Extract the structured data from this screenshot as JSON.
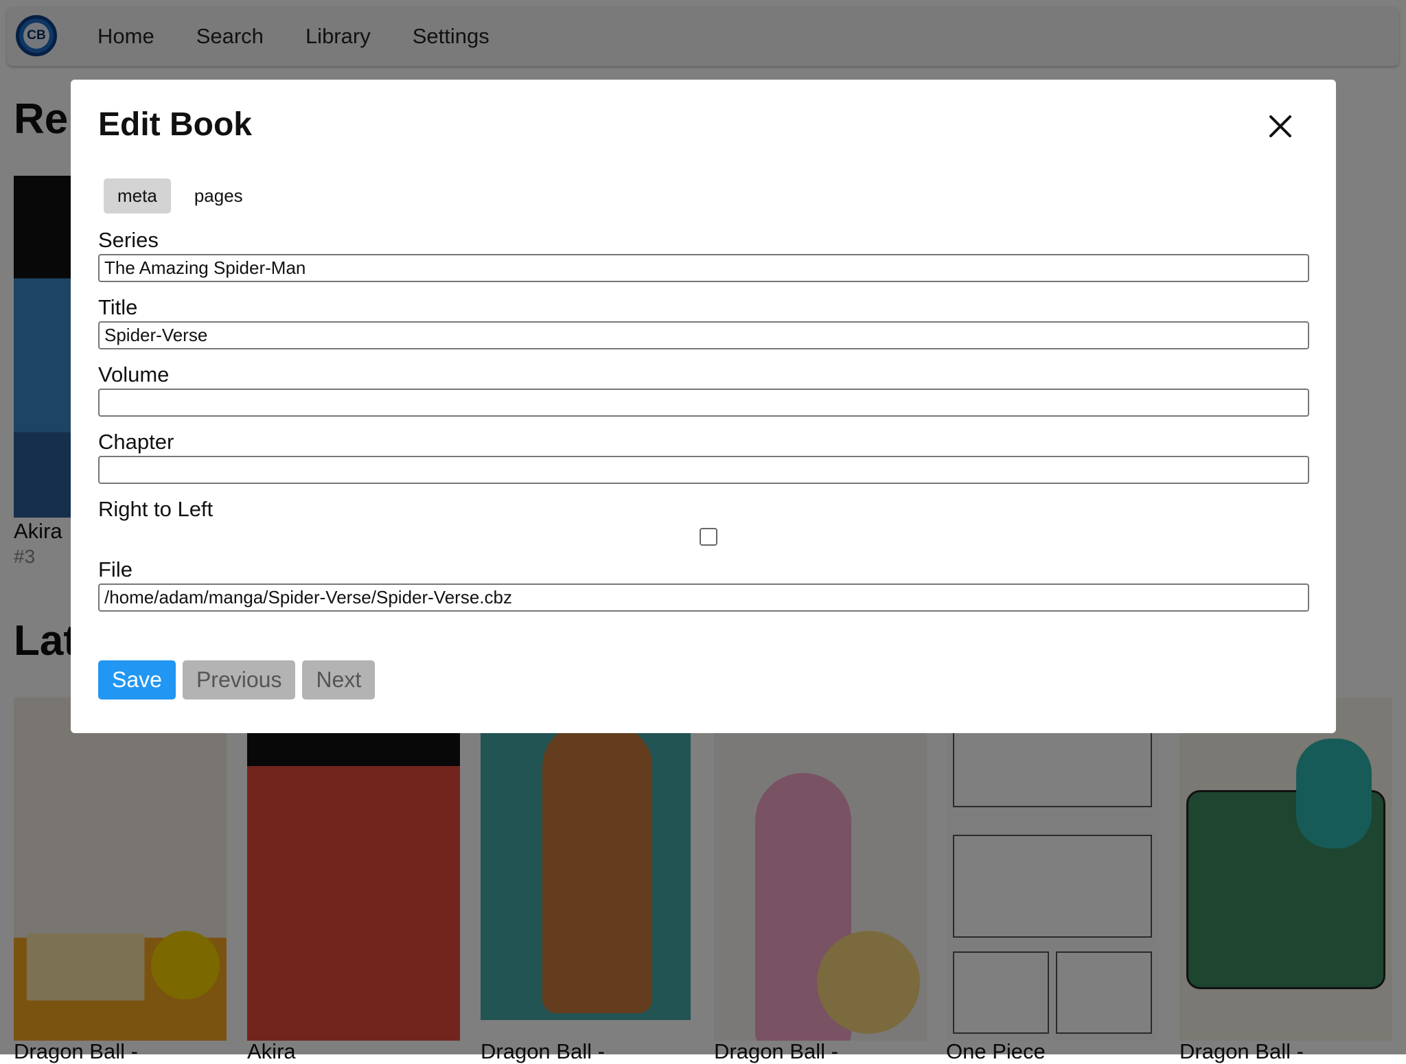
{
  "nav": {
    "logo_text": "CB",
    "items": [
      "Home",
      "Search",
      "Library",
      "Settings"
    ]
  },
  "background": {
    "recent_title": "Re",
    "recent_item": {
      "title": "Akira",
      "subtitle": "#3"
    },
    "latest_title": "Lat",
    "latest_items": [
      {
        "title": "Dragon Ball -"
      },
      {
        "title": "Akira"
      },
      {
        "title": "Dragon Ball -"
      },
      {
        "title": "Dragon Ball -"
      },
      {
        "title": "One Piece"
      },
      {
        "title": "Dragon Ball -"
      }
    ]
  },
  "modal": {
    "title": "Edit Book",
    "tabs": [
      {
        "label": "meta",
        "active": true
      },
      {
        "label": "pages",
        "active": false
      }
    ],
    "fields": {
      "series": {
        "label": "Series",
        "value": "The Amazing Spider-Man"
      },
      "title": {
        "label": "Title",
        "value": "Spider-Verse"
      },
      "volume": {
        "label": "Volume",
        "value": ""
      },
      "chapter": {
        "label": "Chapter",
        "value": ""
      },
      "rtl": {
        "label": "Right to Left",
        "checked": false
      },
      "file": {
        "label": "File",
        "value": "/home/adam/manga/Spider-Verse/Spider-Verse.cbz"
      }
    },
    "buttons": {
      "save": "Save",
      "previous": "Previous",
      "next": "Next"
    }
  },
  "colors": {
    "primary": "#2196f3",
    "secondary_button": "#b3b3b3",
    "overlay": "rgba(0,0,0,0.5)"
  }
}
